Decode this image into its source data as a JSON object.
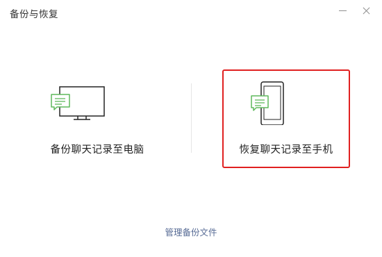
{
  "window": {
    "title": "备份与恢复"
  },
  "options": [
    {
      "id": "backup-to-pc",
      "label": "备份聊天记录至电脑",
      "icon": "monitor-chat-icon"
    },
    {
      "id": "restore-to-phone",
      "label": "恢复聊天记录至手机",
      "icon": "phone-chat-icon",
      "highlighted": true
    }
  ],
  "footer": {
    "manage_label": "管理备份文件"
  },
  "colors": {
    "highlight_border": "#e02020",
    "link": "#576b95",
    "chat_bubble_green": "#5fb85c",
    "device_stroke": "#222222"
  }
}
